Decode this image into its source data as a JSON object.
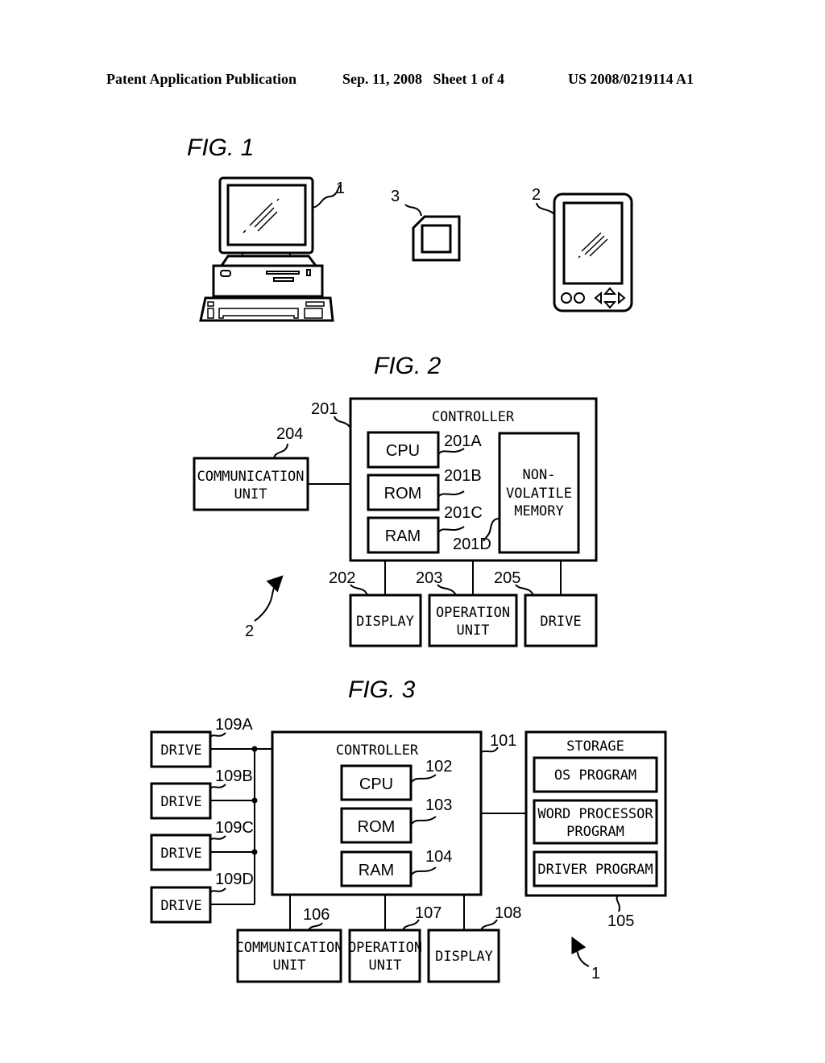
{
  "header": {
    "left": "Patent Application Publication",
    "middle": "Sep. 11, 2008   Sheet 1 of 4",
    "right": "US 2008/0219114 A1"
  },
  "fig1": {
    "title": "FIG. 1",
    "refs": {
      "computer": "1",
      "pda": "2",
      "card": "3"
    }
  },
  "fig2": {
    "title": "FIG. 2",
    "controller": {
      "label": "CONTROLLER",
      "ref": "201"
    },
    "cpu": {
      "label": "CPU",
      "ref": "201A"
    },
    "rom": {
      "label": "ROM",
      "ref": "201B"
    },
    "ram": {
      "label": "RAM",
      "ref": "201C"
    },
    "nvm": {
      "line1": "NON-",
      "line2": "VOLATILE",
      "line3": "MEMORY",
      "ref": "201D"
    },
    "comm": {
      "line1": "COMMUNICATION",
      "line2": "UNIT",
      "ref": "204"
    },
    "display": {
      "label": "DISPLAY",
      "ref": "202"
    },
    "operation": {
      "line1": "OPERATION",
      "line2": "UNIT",
      "ref": "203"
    },
    "drive": {
      "label": "DRIVE",
      "ref": "205"
    },
    "device_ref": "2"
  },
  "fig3": {
    "title": "FIG. 3",
    "controller": {
      "label": "CONTROLLER",
      "ref": "101"
    },
    "cpu": {
      "label": "CPU",
      "ref": "102"
    },
    "rom": {
      "label": "ROM",
      "ref": "103"
    },
    "ram": {
      "label": "RAM",
      "ref": "104"
    },
    "storage": {
      "label": "STORAGE",
      "ref": "105",
      "os": "OS PROGRAM",
      "wp1": "WORD PROCESSOR",
      "wp2": "PROGRAM",
      "driver": "DRIVER PROGRAM"
    },
    "drives": [
      {
        "label": "DRIVE",
        "ref": "109A"
      },
      {
        "label": "DRIVE",
        "ref": "109B"
      },
      {
        "label": "DRIVE",
        "ref": "109C"
      },
      {
        "label": "DRIVE",
        "ref": "109D"
      }
    ],
    "comm": {
      "line1": "COMMUNICATION",
      "line2": "UNIT",
      "ref": "106"
    },
    "operation": {
      "line1": "OPERATION",
      "line2": "UNIT",
      "ref": "107"
    },
    "display": {
      "label": "DISPLAY",
      "ref": "108"
    },
    "device_ref": "1"
  }
}
